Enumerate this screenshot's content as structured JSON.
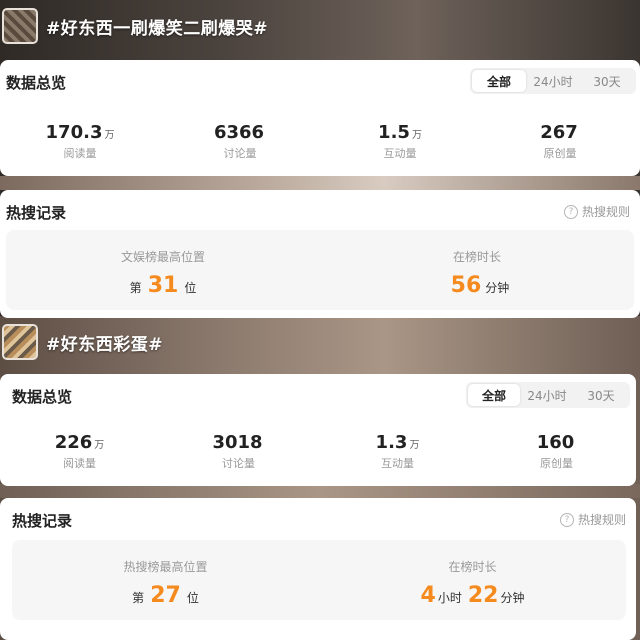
{
  "topic1": {
    "title": "#好东西一刷爆笑二刷爆哭#",
    "overview": {
      "title": "数据总览",
      "tabs": [
        "全部",
        "24小时",
        "30天"
      ],
      "active_tab": 0,
      "stats": [
        {
          "value": "170.3",
          "unit": "万",
          "label": "阅读量"
        },
        {
          "value": "6366",
          "unit": "",
          "label": "讨论量"
        },
        {
          "value": "1.5",
          "unit": "万",
          "label": "互动量"
        },
        {
          "value": "267",
          "unit": "",
          "label": "原创量"
        }
      ]
    },
    "hot": {
      "title": "热搜记录",
      "rules": "热搜规则",
      "position_label": "文娱榜最高位置",
      "position_prefix": "第",
      "position_value": "31",
      "position_suffix": "位",
      "duration_label": "在榜时长",
      "duration_value": "56",
      "duration_unit": "分钟"
    }
  },
  "topic2": {
    "title": "#好东西彩蛋#",
    "overview": {
      "title": "数据总览",
      "tabs": [
        "全部",
        "24小时",
        "30天"
      ],
      "active_tab": 0,
      "stats": [
        {
          "value": "226",
          "unit": "万",
          "label": "阅读量"
        },
        {
          "value": "3018",
          "unit": "",
          "label": "讨论量"
        },
        {
          "value": "1.3",
          "unit": "万",
          "label": "互动量"
        },
        {
          "value": "160",
          "unit": "",
          "label": "原创量"
        }
      ]
    },
    "hot": {
      "title": "热搜记录",
      "rules": "热搜规则",
      "position_label": "热搜榜最高位置",
      "position_prefix": "第",
      "position_value": "27",
      "position_suffix": "位",
      "duration_label": "在榜时长",
      "duration_hours": "4",
      "duration_hours_unit": "小时",
      "duration_minutes": "22",
      "duration_minutes_unit": "分钟"
    }
  },
  "colors": {
    "accent": "#f58a1f",
    "card": "#ffffff",
    "inner": "#f6f6f6"
  },
  "icons": [
    "question-circle-icon"
  ]
}
